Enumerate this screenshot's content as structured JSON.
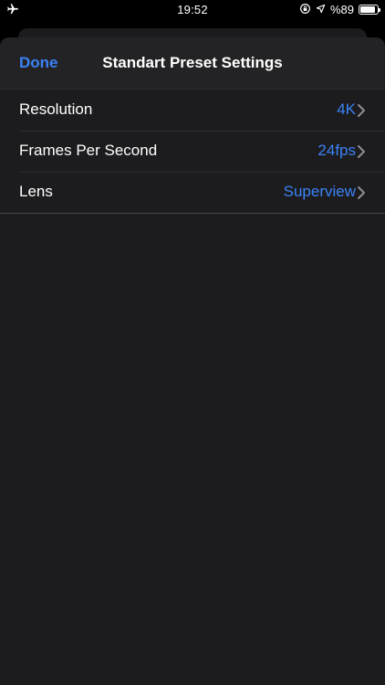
{
  "status_bar": {
    "time": "19:52",
    "battery_text": "%89",
    "battery_level": 0.89,
    "left_icon": "airplane-icon",
    "right_icons": [
      "orientation-lock-icon",
      "location-arrow-icon",
      "battery-icon"
    ]
  },
  "nav": {
    "done_label": "Done",
    "title": "Standart Preset Settings"
  },
  "settings": {
    "rows": [
      {
        "label": "Resolution",
        "value": "4K"
      },
      {
        "label": "Frames Per Second",
        "value": "24fps"
      },
      {
        "label": "Lens",
        "value": "Superview"
      }
    ]
  },
  "colors": {
    "accent": "#3b82f6",
    "background": "#1c1c1e",
    "text": "#ffffff"
  }
}
